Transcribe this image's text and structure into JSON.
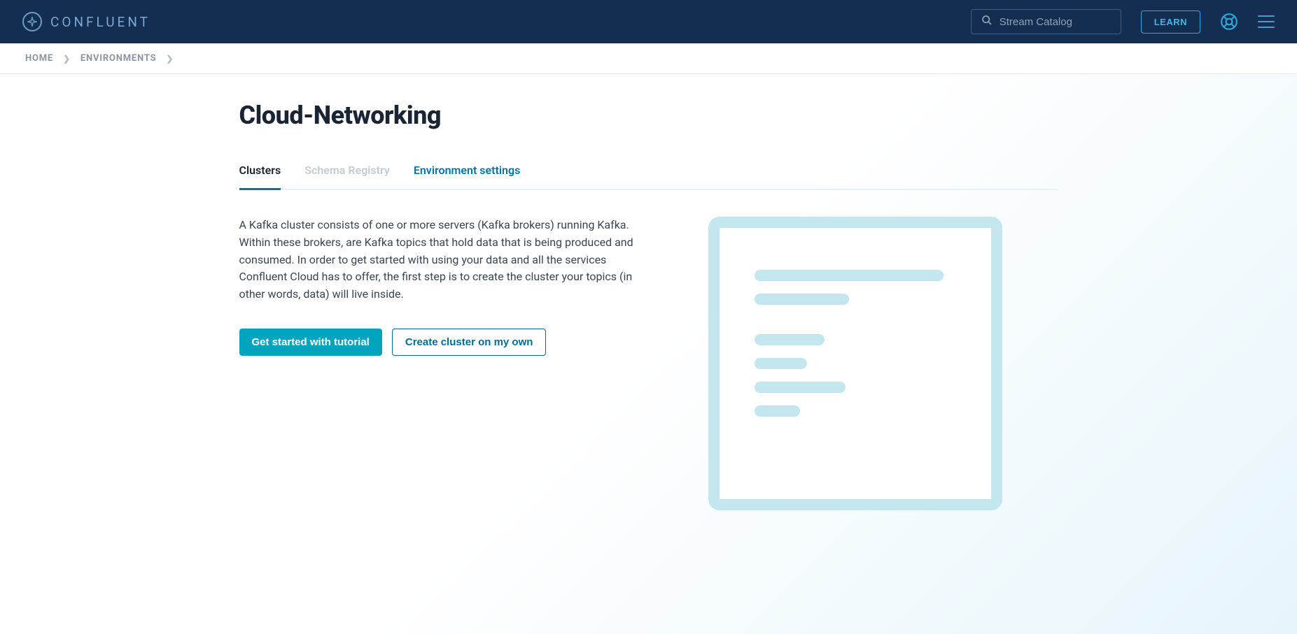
{
  "header": {
    "logo_text": "CONFLUENT",
    "search_placeholder": "Stream Catalog",
    "learn_label": "LEARN"
  },
  "breadcrumb": {
    "items": [
      "HOME",
      "ENVIRONMENTS"
    ]
  },
  "page": {
    "title": "Cloud-Networking"
  },
  "tabs": [
    {
      "label": "Clusters",
      "active": true,
      "disabled": false
    },
    {
      "label": "Schema Registry",
      "active": false,
      "disabled": true
    },
    {
      "label": "Environment settings",
      "active": false,
      "disabled": false
    }
  ],
  "content": {
    "description": "A Kafka cluster consists of one or more servers (Kafka brokers) running Kafka. Within these brokers, are Kafka topics that hold data that is being produced and consumed. In order to get started with using your data and all the services Confluent Cloud has to offer, the first step is to create the cluster your topics (in other words, data) will live inside.",
    "primary_button": "Get started with tutorial",
    "secondary_button": "Create cluster on my own"
  }
}
